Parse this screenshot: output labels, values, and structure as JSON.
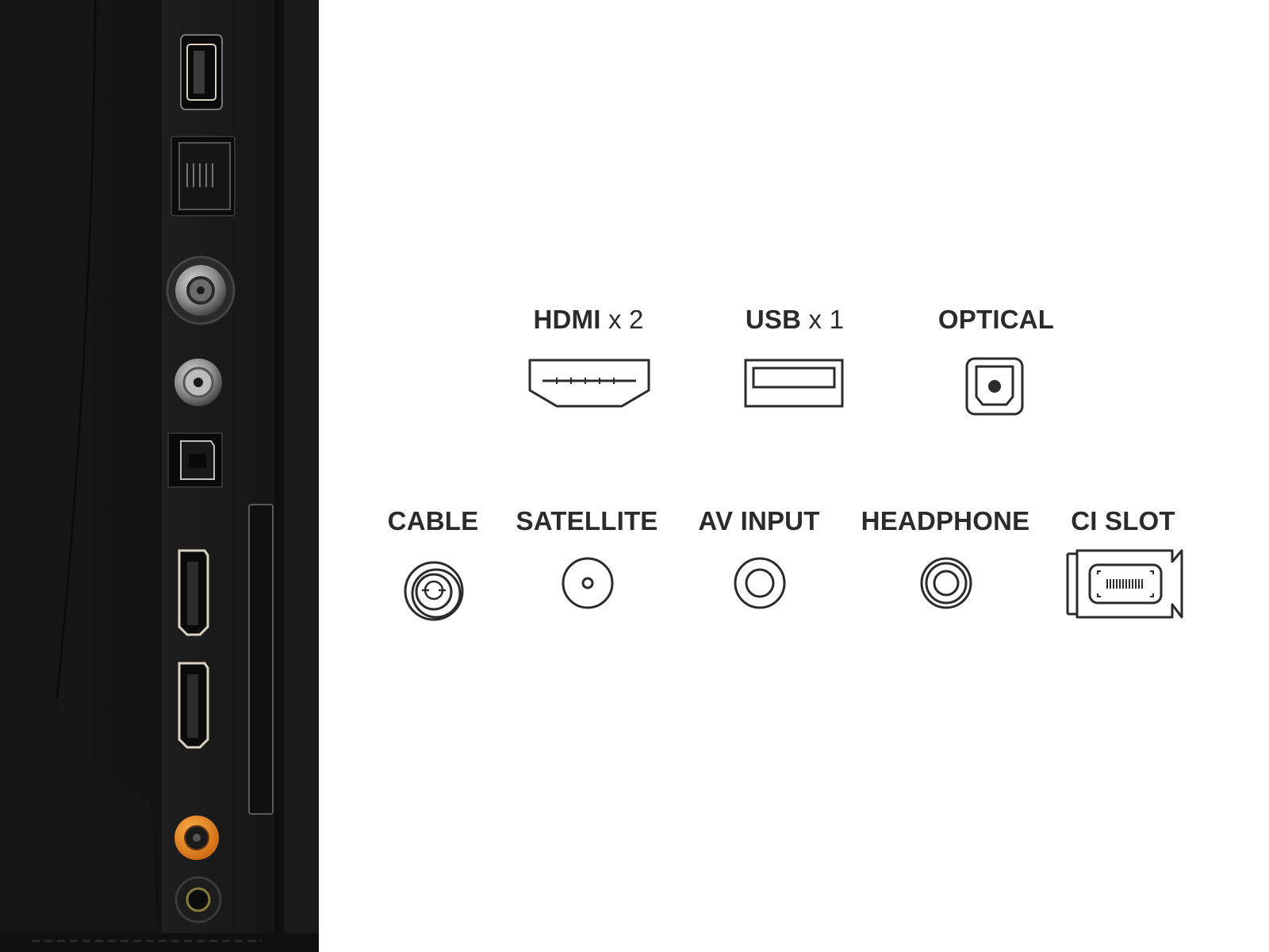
{
  "colors": {
    "tv_body": "#141414",
    "port_panel": "#1c1c1c",
    "icon_stroke": "#2b2b2b",
    "label_text": "#2b2b2b",
    "av_jack_orange": "#e8891e",
    "av_jack_yellow": "#c9a227"
  },
  "ports_top_row": [
    {
      "name": "HDMI",
      "qty": "x 2",
      "icon": "hdmi-port-icon"
    },
    {
      "name": "USB",
      "qty": "x 1",
      "icon": "usb-port-icon"
    },
    {
      "name": "OPTICAL",
      "qty": "",
      "icon": "optical-port-icon"
    }
  ],
  "ports_bottom_row": [
    {
      "name": "CABLE",
      "icon": "cable-port-icon"
    },
    {
      "name": "SATELLITE",
      "icon": "satellite-port-icon"
    },
    {
      "name": "AV INPUT",
      "icon": "av-input-port-icon"
    },
    {
      "name": "HEADPHONE",
      "icon": "headphone-port-icon"
    },
    {
      "name": "CI SLOT",
      "icon": "ci-slot-icon"
    }
  ],
  "photo": {
    "subject": "tv-rear-ports-photo",
    "ports_shown": [
      "usb",
      "ethernet",
      "cable",
      "satellite",
      "optical",
      "hdmi",
      "hdmi",
      "av-input",
      "headphone"
    ]
  }
}
